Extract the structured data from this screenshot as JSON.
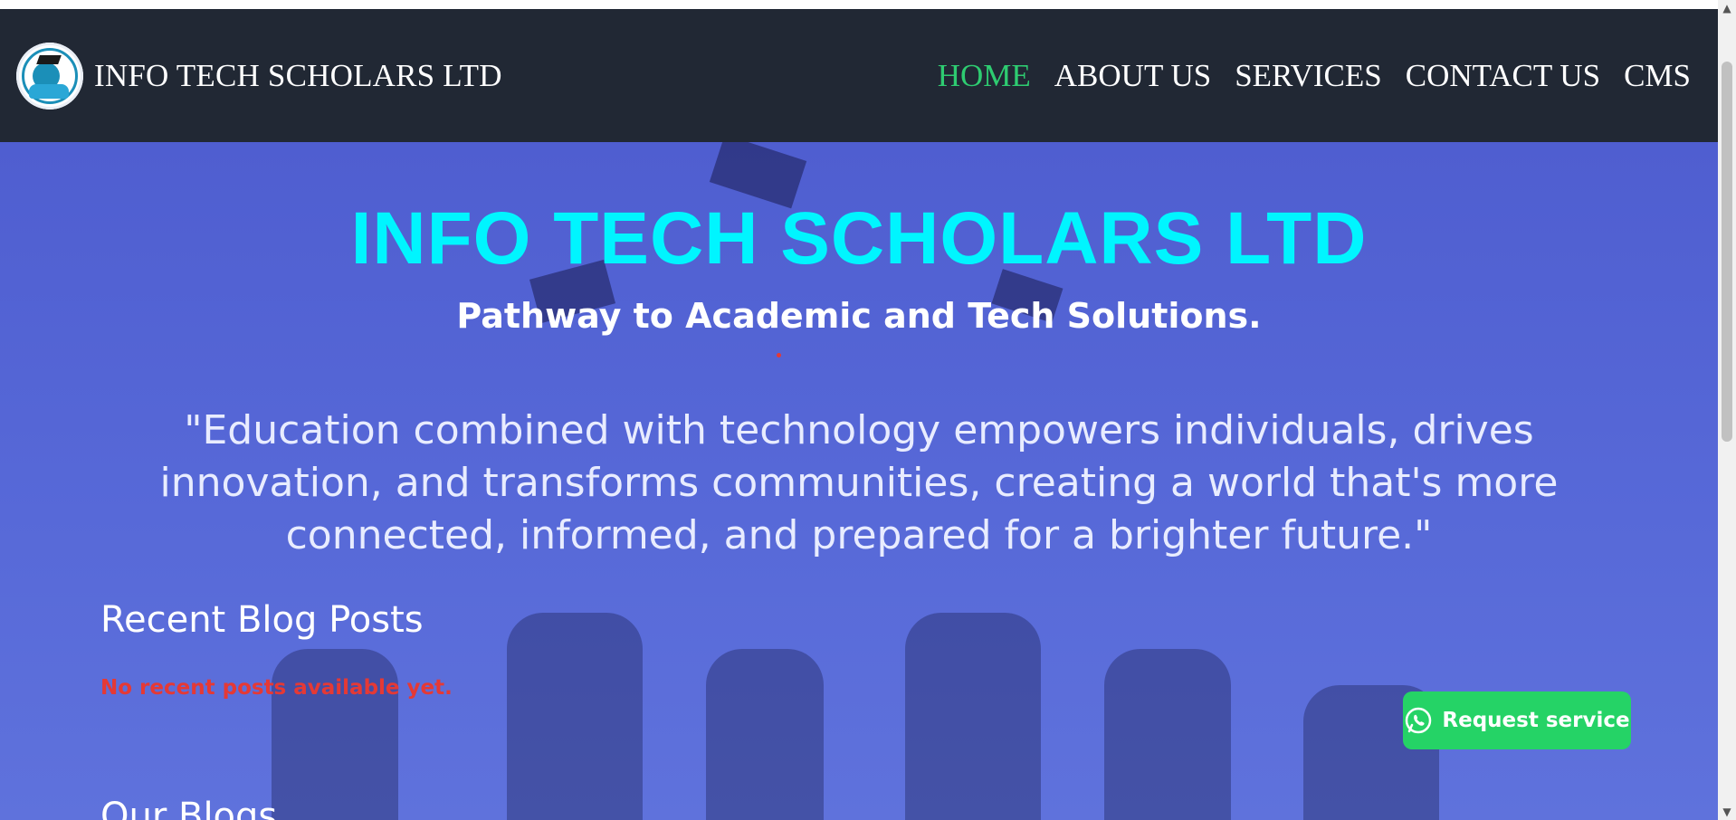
{
  "nav": {
    "brand": "INFO TECH SCHOLARS LTD",
    "items": [
      {
        "label": "HOME",
        "active": true
      },
      {
        "label": "ABOUT US",
        "active": false
      },
      {
        "label": "SERVICES",
        "active": false
      },
      {
        "label": "CONTACT US",
        "active": false
      },
      {
        "label": "CMS",
        "active": false
      }
    ]
  },
  "hero": {
    "title": "INFO TECH SCHOLARS LTD",
    "subtitle": "Pathway to Academic and Tech Solutions.",
    "quote": "\"Education combined with technology empowers individuals, drives innovation, and transforms communities, creating a world that's more connected, informed, and prepared for a brighter future.\""
  },
  "blog": {
    "recent_title": "Recent Blog Posts",
    "empty_message": "No recent posts available yet.",
    "our_blogs_title": "Our Blogs"
  },
  "cta": {
    "request_label": "Request service",
    "icon": "whatsapp-icon"
  },
  "colors": {
    "nav_bg": "#212834",
    "active_link": "#2ecc71",
    "title": "#00f5ff",
    "overlay": "#5463d6",
    "cta": "#25d366",
    "error": "#e53935"
  }
}
